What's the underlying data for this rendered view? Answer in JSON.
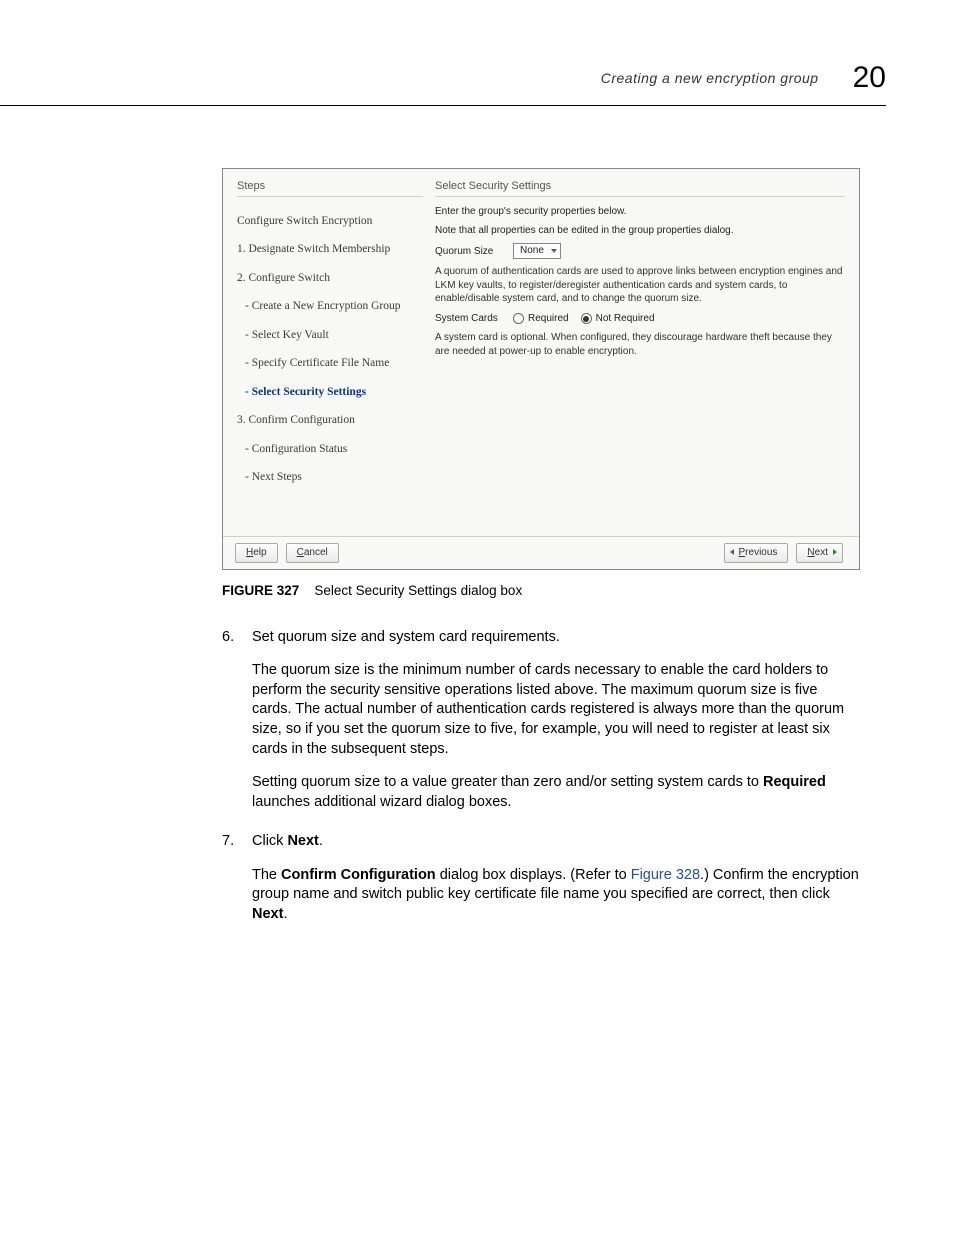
{
  "page": {
    "running_title": "Creating a new encryption group",
    "chapter_number": "20"
  },
  "dialog": {
    "steps_label": "Steps",
    "steps_heading": "Configure Switch Encryption",
    "steps": {
      "s1": "1. Designate Switch Membership",
      "s2": "2. Configure Switch",
      "s2a": "- Create a New Encryption Group",
      "s2b": "- Select Key Vault",
      "s2c": "- Specify Certificate File Name",
      "s2d": "- Select Security Settings",
      "s3": "3. Confirm Configuration",
      "s3a": "- Configuration Status",
      "s3b": "- Next Steps"
    },
    "main_title": "Select Security Settings",
    "intro_line_1": "Enter the group's security properties below.",
    "intro_line_2": "Note that all properties can be edited in the group properties dialog.",
    "quorum_label": "Quorum Size",
    "quorum_value": "None",
    "quorum_note": "A quorum of authentication cards are used to approve links between encryption engines and LKM key vaults, to register/deregister authentication cards and system cards, to enable/disable system card, and to change the quorum size.",
    "system_label": "System Cards",
    "sys_opt_required": "Required",
    "sys_opt_notreq": "Not Required",
    "system_note": "A system card is optional. When configured, they discourage hardware theft because they are needed at power-up to enable encryption.",
    "btn_help": "Help",
    "btn_cancel": "Cancel",
    "btn_prev": "Previous",
    "btn_next": "Next"
  },
  "figure": {
    "label": "FIGURE 327",
    "caption": "Select Security Settings dialog box"
  },
  "body": {
    "step6_num": "6.",
    "step6_head": "Set quorum size and system card requirements.",
    "step6_p1": "The quorum size is the minimum number of cards necessary to enable the card holders to perform the security sensitive operations listed above. The maximum quorum size is five cards. The actual number of authentication cards registered is always more than the quorum size, so if you set the quorum size to five, for example, you will need to register at least six cards in the subsequent steps.",
    "step6_p2a": "Setting quorum size to a value greater than zero and/or setting system cards to ",
    "step6_p2b": "Required",
    "step6_p2c": " launches additional wizard dialog boxes.",
    "step7_num": "7.",
    "step7_a": "Click ",
    "step7_b": "Next",
    "step7_c": ".",
    "step7_p2a": "The ",
    "step7_p2b": "Confirm Configuration",
    "step7_p2c": " dialog box displays. (Refer to ",
    "step7_link": "Figure 328",
    "step7_p2d": ".) Confirm the encryption group name and switch public key certificate file name you specified are correct, then click ",
    "step7_p2e": "Next",
    "step7_p2f": "."
  }
}
